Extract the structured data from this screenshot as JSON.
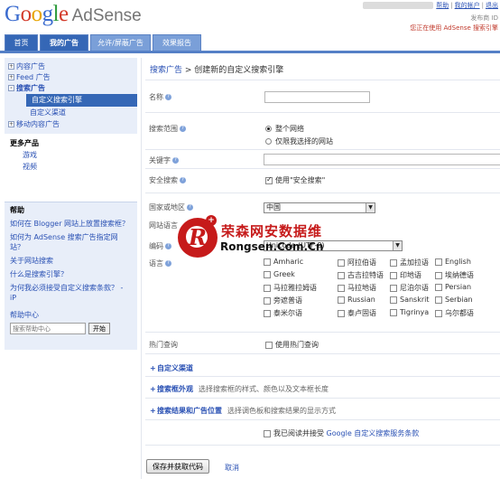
{
  "brand": {
    "google": "Google",
    "product": "AdSense"
  },
  "account": {
    "links": [
      "帮助",
      "我的帐户",
      "退出"
    ],
    "line2": "发布商 ID",
    "line3": "您正在使用 AdSense 搜索引擎"
  },
  "tabs": [
    {
      "label": "首页"
    },
    {
      "label": "我的广告"
    },
    {
      "label": "允许/屏蔽广告"
    },
    {
      "label": "效果报告"
    }
  ],
  "sidebar": {
    "items": [
      {
        "label": "内容广告",
        "toggle": "+"
      },
      {
        "label": "Feed 广告",
        "toggle": "+"
      },
      {
        "label": "搜索广告",
        "toggle": "-"
      },
      {
        "label": "移动内容广告",
        "toggle": "+"
      }
    ],
    "sub": [
      {
        "label": "自定义搜索引擎"
      },
      {
        "label": "自定义渠道"
      }
    ],
    "more": {
      "heading": "更多产品",
      "items": [
        "游戏",
        "视频"
      ]
    }
  },
  "help": {
    "heading": "帮助",
    "questions": [
      "如何在 Blogger 网站上放置搜索框？",
      "如何为 AdSense 搜索广告指定网站？",
      "关于网站搜索",
      "什么是搜索引擎？",
      "为何我必须接受自定义搜索条款？ - iP"
    ],
    "center": "帮助中心",
    "search_placeholder": "搜索帮助中心",
    "search_button": "开始"
  },
  "main": {
    "breadcrumb_link": "搜索广告",
    "breadcrumb_rest": " > 创建新的自定义搜索引擎",
    "labels": {
      "name": "名称",
      "scope": "搜索范围",
      "keywords": "关键字",
      "safesearch": "安全搜索",
      "country": "国家或地区",
      "site_lang": "网站语言",
      "encoding": "编码",
      "language": "语言",
      "trends": "热门查询"
    },
    "scope_options": [
      "整个网络",
      "仅限我选择的网站"
    ],
    "safesearch_label": "使用\"安全搜索\"",
    "country_value": "中国",
    "encoding_value": "Unicode (UTF-8)",
    "languages": [
      [
        "Amharic",
        "阿拉伯语",
        "孟加拉语",
        "English"
      ],
      [
        "Greek",
        "古吉拉特语",
        "印地语",
        "埃纳德语"
      ],
      [
        "马拉雅拉姆语",
        "马拉地语",
        "尼泊尔语",
        "Persian"
      ],
      [
        "旁遮普语",
        "Russian",
        "Sanskrit",
        "Serbian"
      ],
      [
        "泰米尔语",
        "泰卢固语",
        "Tigrinya",
        "乌尔都语"
      ]
    ],
    "trends_label": "使用热门查询",
    "sections": [
      {
        "title": "自定义渠道",
        "desc": ""
      },
      {
        "title": "搜索框外观",
        "desc": "选择搜索框的样式、颜色以及文本框长度"
      },
      {
        "title": "搜索结果和广告位置",
        "desc": "选择调色板和搜索结果的显示方式"
      }
    ],
    "agree_prefix": "我已阅读并接受",
    "agree_link": "Google 自定义搜索服务条款",
    "save_button": "保存并获取代码",
    "cancel_link": "取消"
  },
  "watermark": {
    "letter": "R",
    "cn": "荣森网安数据维",
    "en": "Rongsen.Com.Cn"
  },
  "colors": {
    "tab_active": "#3567b6",
    "tab": "#7a9fd8",
    "link": "#2a51b4",
    "sidebar_bg": "#e8eef9",
    "watermark": "#c61a1a"
  }
}
